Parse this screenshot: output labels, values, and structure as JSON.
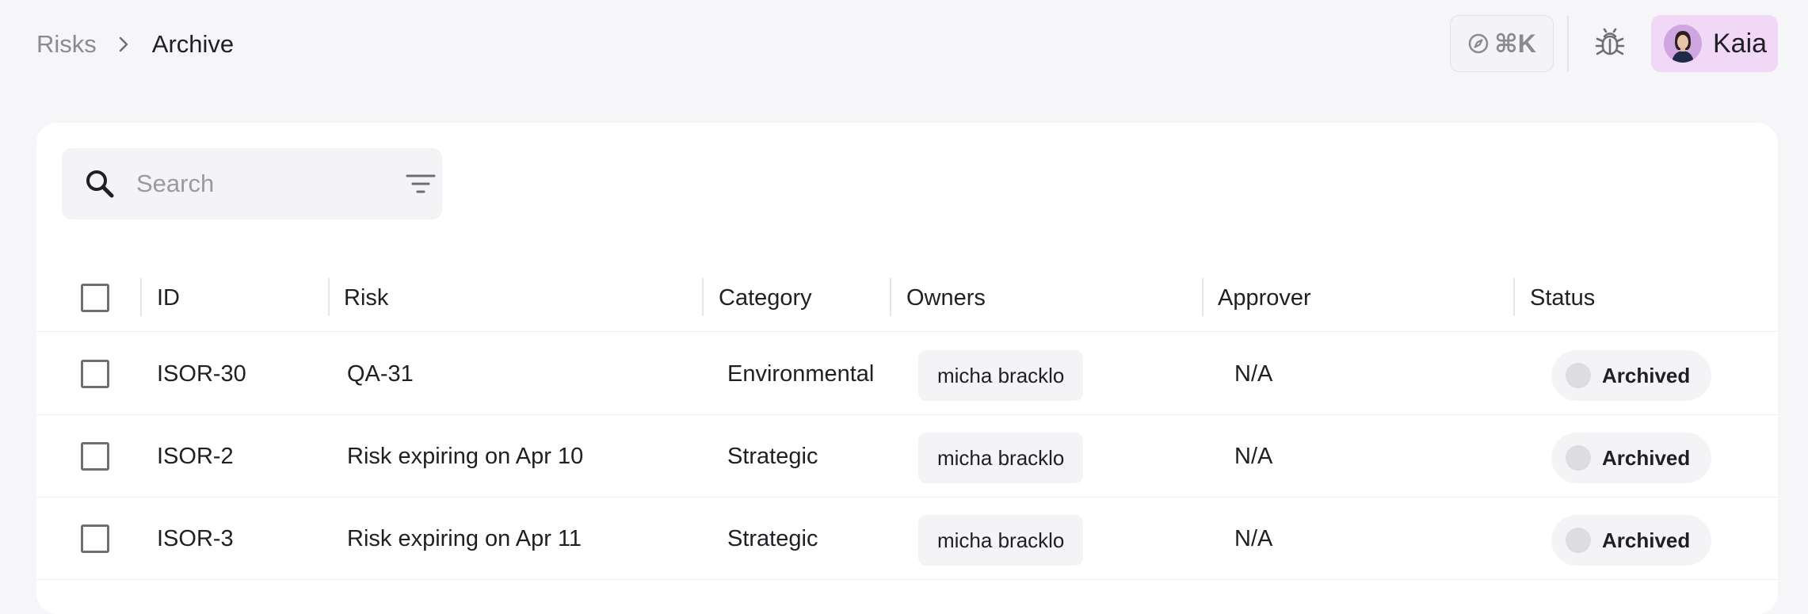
{
  "breadcrumb": {
    "parent": "Risks",
    "current": "Archive"
  },
  "header": {
    "command_shortcut": "⌘K",
    "user_name": "Kaia"
  },
  "search": {
    "placeholder": "Search",
    "value": ""
  },
  "table": {
    "columns": {
      "id": "ID",
      "risk": "Risk",
      "category": "Category",
      "owners": "Owners",
      "approver": "Approver",
      "status": "Status"
    },
    "rows": [
      {
        "id": "ISOR-30",
        "risk": "QA-31",
        "category": "Environmental",
        "owner": "micha bracklo",
        "approver": "N/A",
        "status": "Archived"
      },
      {
        "id": "ISOR-2",
        "risk": "Risk expiring on Apr 10",
        "category": "Strategic",
        "owner": "micha bracklo",
        "approver": "N/A",
        "status": "Archived"
      },
      {
        "id": "ISOR-3",
        "risk": "Risk expiring on Apr 11",
        "category": "Strategic",
        "owner": "micha bracklo",
        "approver": "N/A",
        "status": "Archived"
      }
    ]
  },
  "colors": {
    "page_bg": "#f6f6f8",
    "user_button_bg": "#f0d8f6",
    "status_dot": "#dddde0"
  },
  "icons": [
    "chevron-right-icon",
    "compass-icon",
    "bug-icon",
    "search-icon",
    "filter-icon"
  ]
}
